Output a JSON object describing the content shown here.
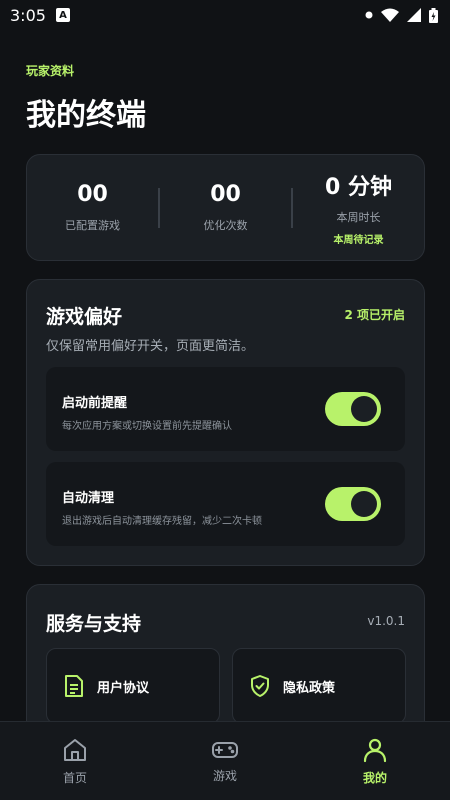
{
  "status_bar": {
    "time": "3:05",
    "notification_letter": "A"
  },
  "header": {
    "subtitle": "玩家资料",
    "title": "我的终端"
  },
  "stats": [
    {
      "value": "00",
      "label": "已配置游戏",
      "note": ""
    },
    {
      "value": "00",
      "label": "优化次数",
      "note": ""
    },
    {
      "value": "0 分钟",
      "label": "本周时长",
      "note": "本周待记录"
    }
  ],
  "preferences": {
    "title": "游戏偏好",
    "enabled_count": "2 项已开启",
    "description": "仅保留常用偏好开关，页面更简洁。",
    "items": [
      {
        "title": "启动前提醒",
        "description": "每次应用方案或切换设置前先提醒确认",
        "enabled": true
      },
      {
        "title": "自动清理",
        "description": "退出游戏后自动清理缓存残留，减少二次卡顿",
        "enabled": true
      }
    ]
  },
  "service": {
    "title": "服务与支持",
    "version": "v1.0.1",
    "buttons": [
      {
        "label": "用户协议",
        "icon": "document-icon"
      },
      {
        "label": "隐私政策",
        "icon": "shield-check-icon"
      }
    ]
  },
  "bottom_nav": {
    "items": [
      {
        "label": "首页",
        "icon": "home-icon",
        "active": false
      },
      {
        "label": "游戏",
        "icon": "gamepad-icon",
        "active": false
      },
      {
        "label": "我的",
        "icon": "user-icon",
        "active": true
      }
    ]
  },
  "colors": {
    "accent": "#b8f26a",
    "background": "#101215",
    "card": "#1b1f24"
  }
}
